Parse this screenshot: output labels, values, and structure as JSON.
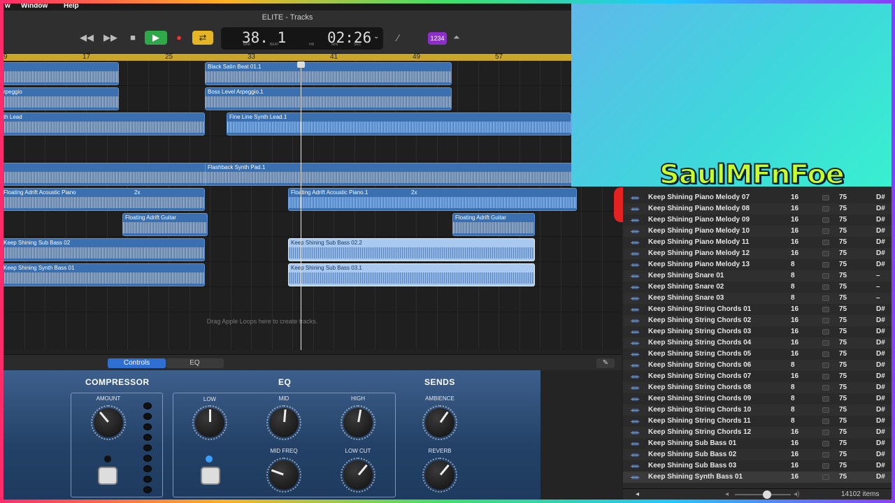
{
  "menubar": {
    "left": "w",
    "window": "Window",
    "help": "Help"
  },
  "toolbar": {
    "title": "ELITE - Tracks",
    "rewind": "◀◀",
    "forward": "▶▶",
    "stop": "■",
    "play": "▶",
    "record": "●",
    "cycle": "⇄",
    "lcd_bars": "38. 1",
    "lcd_time": "02:26",
    "lcd_bar_label": "BAR",
    "lcd_beat_label": "BEAT",
    "lcd_hr_label": "HR",
    "lcd_min_label": "MIN",
    "lcd_sec_label": "SEC",
    "count_in_badge": "1234"
  },
  "ruler": {
    "marks": [
      "9",
      "17",
      "25",
      "33",
      "41",
      "49",
      "57"
    ]
  },
  "regions": [
    {
      "title": "",
      "lane": 0
    },
    {
      "title": "Black Satin Beat 01.1",
      "lane": 0
    },
    {
      "title": "rpeggio",
      "lane": 1
    },
    {
      "title": "Boss Level Arpeggio.1",
      "lane": 1
    },
    {
      "title": "th Lead",
      "lane": 2
    },
    {
      "title": "Fine Line Synth Lead.1",
      "lane": 2
    },
    {
      "title": "",
      "lane": 4
    },
    {
      "title": "Flashback Synth Pad.1",
      "lane": 4
    },
    {
      "title": "Floating Adrift Acoustic Piano",
      "lane": 5
    },
    {
      "title": "Floating Adrift Acoustic Piano.1",
      "lane": 5
    },
    {
      "title": "Floating Adrift Guitar",
      "lane": 6
    },
    {
      "title": "Floating Adrift Guitar",
      "lane": 6
    },
    {
      "title": "Keep Shining Sub Bass 02",
      "lane": 7
    },
    {
      "title": "Keep Shining Sub Bass 02.2",
      "lane": 7
    },
    {
      "title": "Keep Shining Synth Bass 01",
      "lane": 8
    },
    {
      "title": "Keep Shining Sub Bass 03.1",
      "lane": 8
    }
  ],
  "loop_suffix": "2x",
  "drop_hint": "Drag Apple Loops here to create tracks.",
  "smart_controls": {
    "tab_controls": "Controls",
    "tab_eq": "EQ",
    "edit_icon": "✎",
    "compressor_title": "COMPRESSOR",
    "eq_title": "EQ",
    "sends_title": "SENDS",
    "amount": "AMOUNT",
    "low": "LOW",
    "mid": "MID",
    "high": "HIGH",
    "mid_freq": "MID FREQ",
    "low_cut": "LOW CUT",
    "ambience": "AMBIENCE",
    "reverb": "REVERB"
  },
  "overlay": {
    "brand": "SaulMFnFoe",
    "social_icons": [
      "youtube-icon",
      "apple-icon",
      "music-note-icon",
      "soundcloud-icon",
      "facebook-icon",
      "instagram-icon"
    ],
    "brand_color": "#c7ff2a"
  },
  "browser": {
    "rows": [
      {
        "name": "Keep Shining Piano Melody 07",
        "beats": "16",
        "tempo": "75",
        "key": "D#"
      },
      {
        "name": "Keep Shining Piano Melody 08",
        "beats": "16",
        "tempo": "75",
        "key": "D#"
      },
      {
        "name": "Keep Shining Piano Melody 09",
        "beats": "16",
        "tempo": "75",
        "key": "D#"
      },
      {
        "name": "Keep Shining Piano Melody 10",
        "beats": "16",
        "tempo": "75",
        "key": "D#"
      },
      {
        "name": "Keep Shining Piano Melody 11",
        "beats": "16",
        "tempo": "75",
        "key": "D#"
      },
      {
        "name": "Keep Shining Piano Melody 12",
        "beats": "16",
        "tempo": "75",
        "key": "D#"
      },
      {
        "name": "Keep Shining Piano Melody 13",
        "beats": "8",
        "tempo": "75",
        "key": "D#"
      },
      {
        "name": "Keep Shining Snare 01",
        "beats": "8",
        "tempo": "75",
        "key": "–"
      },
      {
        "name": "Keep Shining Snare 02",
        "beats": "8",
        "tempo": "75",
        "key": "–"
      },
      {
        "name": "Keep Shining Snare 03",
        "beats": "8",
        "tempo": "75",
        "key": "–"
      },
      {
        "name": "Keep Shining String Chords 01",
        "beats": "16",
        "tempo": "75",
        "key": "D#"
      },
      {
        "name": "Keep Shining String Chords 02",
        "beats": "16",
        "tempo": "75",
        "key": "D#"
      },
      {
        "name": "Keep Shining String Chords 03",
        "beats": "16",
        "tempo": "75",
        "key": "D#"
      },
      {
        "name": "Keep Shining String Chords 04",
        "beats": "16",
        "tempo": "75",
        "key": "D#"
      },
      {
        "name": "Keep Shining String Chords 05",
        "beats": "16",
        "tempo": "75",
        "key": "D#"
      },
      {
        "name": "Keep Shining String Chords 06",
        "beats": "8",
        "tempo": "75",
        "key": "D#"
      },
      {
        "name": "Keep Shining String Chords 07",
        "beats": "16",
        "tempo": "75",
        "key": "D#"
      },
      {
        "name": "Keep Shining String Chords 08",
        "beats": "8",
        "tempo": "75",
        "key": "D#"
      },
      {
        "name": "Keep Shining String Chords 09",
        "beats": "8",
        "tempo": "75",
        "key": "D#"
      },
      {
        "name": "Keep Shining String Chords 10",
        "beats": "8",
        "tempo": "75",
        "key": "D#"
      },
      {
        "name": "Keep Shining String Chords 11",
        "beats": "8",
        "tempo": "75",
        "key": "D#"
      },
      {
        "name": "Keep Shining String Chords 12",
        "beats": "16",
        "tempo": "75",
        "key": "D#"
      },
      {
        "name": "Keep Shining Sub Bass 01",
        "beats": "16",
        "tempo": "75",
        "key": "D#"
      },
      {
        "name": "Keep Shining Sub Bass 02",
        "beats": "16",
        "tempo": "75",
        "key": "D#"
      },
      {
        "name": "Keep Shining Sub Bass 03",
        "beats": "16",
        "tempo": "75",
        "key": "D#"
      },
      {
        "name": "Keep Shining Synth Bass 01",
        "beats": "16",
        "tempo": "75",
        "key": "D#"
      }
    ],
    "item_count": "14102 items"
  }
}
